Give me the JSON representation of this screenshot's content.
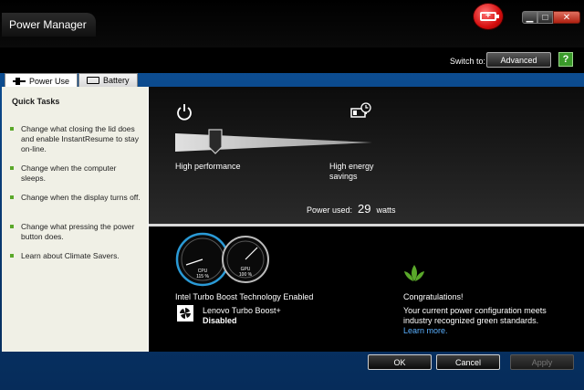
{
  "window": {
    "title": "Power Manager"
  },
  "controls": {
    "minimize": "▁",
    "maximize": "□",
    "close": "✕"
  },
  "header": {
    "switch_label": "Switch to:",
    "advanced_button": "Advanced",
    "help": "?"
  },
  "tabs": [
    {
      "label": "Power Use",
      "icon": "plug-icon",
      "active": true
    },
    {
      "label": "Battery",
      "icon": "battery-icon",
      "active": false
    }
  ],
  "sidebar": {
    "title": "Quick Tasks",
    "tasks": [
      "Change what closing the lid does and enable InstantResume to stay on-line.",
      "Change when the computer sleeps.",
      "Change when the display turns off.",
      "Change what pressing the power button does.",
      "Learn about Climate Savers."
    ]
  },
  "slider": {
    "left_label": "High performance",
    "right_label": "High energy savings",
    "level": 0.18
  },
  "power": {
    "label": "Power used:",
    "value": "29",
    "unit": "watts"
  },
  "gauges": [
    {
      "name": "CPU",
      "value": "115 %"
    },
    {
      "name": "GPU",
      "value": "100 %"
    }
  ],
  "turbo": {
    "title": "Intel Turbo Boost Technology Enabled",
    "name": "Lenovo Turbo Boost+",
    "status": "Disabled"
  },
  "green": {
    "title": "Congratulations!",
    "message": "Your current power configuration meets industry recognized green standards.",
    "link": "Learn more."
  },
  "footer": {
    "ok": "OK",
    "cancel": "Cancel",
    "apply": "Apply"
  },
  "colors": {
    "accent_green": "#5aa82a",
    "link": "#5ab0ff",
    "gauge": "#2a9ad6"
  }
}
